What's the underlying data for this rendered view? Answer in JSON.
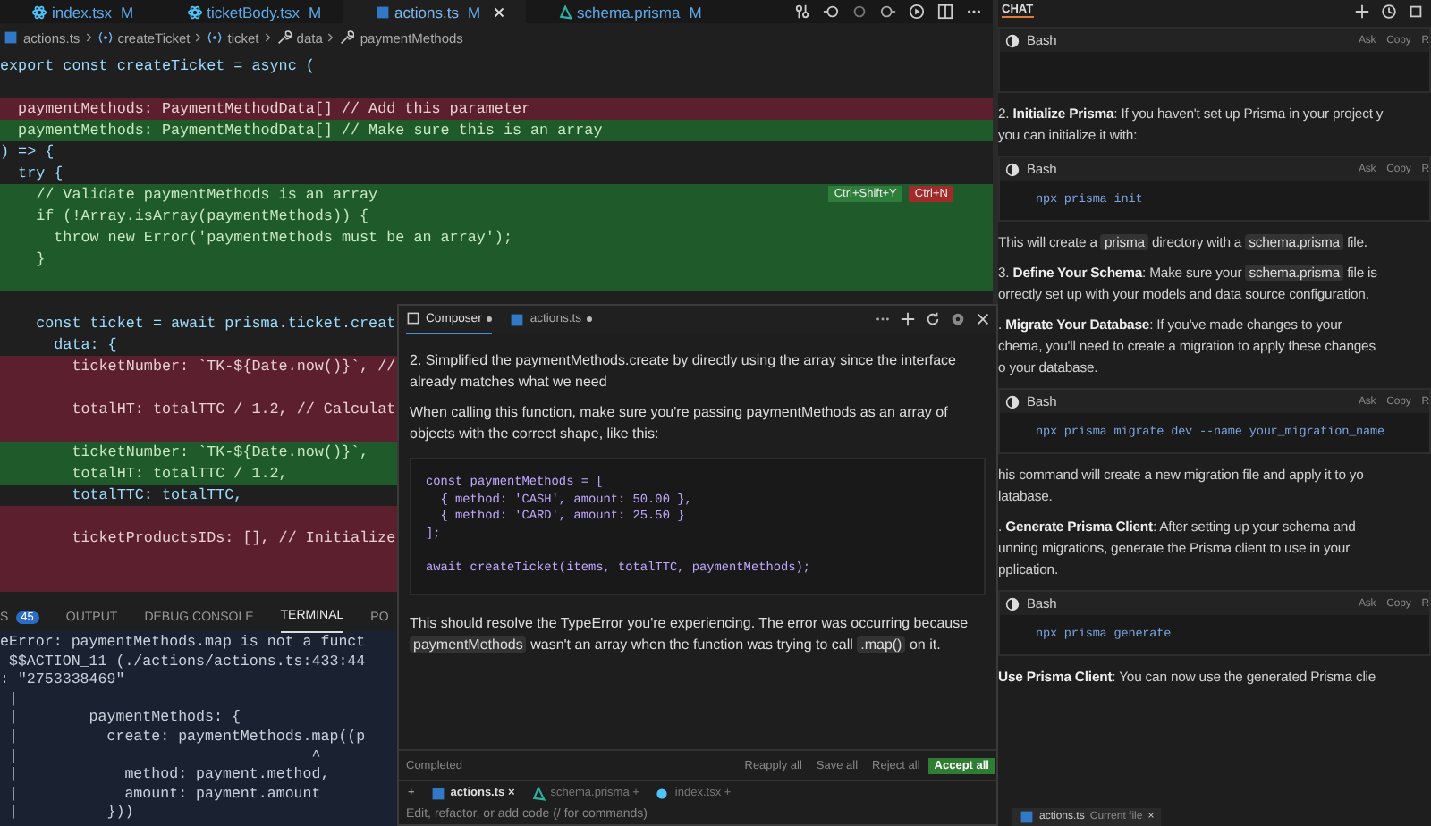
{
  "editor_tabs": [
    {
      "label": "index.tsx",
      "badge": "M",
      "kind": "react",
      "selected": false
    },
    {
      "label": "ticketBody.tsx",
      "badge": "M",
      "kind": "react",
      "selected": false
    },
    {
      "label": "actions.ts",
      "badge": "M",
      "kind": "ts",
      "selected": true
    },
    {
      "label": "schema.prisma",
      "badge": "M",
      "kind": "prisma",
      "selected": false
    }
  ],
  "breadcrumbs": [
    {
      "label": "actions.ts",
      "kind": "file"
    },
    {
      "label": "createTicket",
      "kind": "symbol"
    },
    {
      "label": "ticket",
      "kind": "symbol"
    },
    {
      "label": "data",
      "kind": "property"
    },
    {
      "label": "paymentMethods",
      "kind": "property"
    }
  ],
  "code_lines": [
    {
      "kind": "normal",
      "text": "export const createTicket = async ("
    },
    {
      "kind": "normal"
    },
    {
      "kind": "removed",
      "text": "  paymentMethods: PaymentMethodData[] // Add this parameter"
    },
    {
      "kind": "added",
      "text": "  paymentMethods: PaymentMethodData[] // Make sure this is an array"
    },
    {
      "kind": "normal",
      "text": ") => {"
    },
    {
      "kind": "normal",
      "text": "  try {"
    },
    {
      "kind": "added",
      "text": "    // Validate paymentMethods is an array",
      "keybindings": [
        {
          "label": "Ctrl+Shift+Y",
          "kind": "accept"
        },
        {
          "label": "Ctrl+N",
          "kind": "reject"
        }
      ]
    },
    {
      "kind": "added",
      "text": "    if (!Array.isArray(paymentMethods)) {"
    },
    {
      "kind": "added",
      "text": "      throw new Error('paymentMethods must be an array');"
    },
    {
      "kind": "added",
      "text": "    }"
    },
    {
      "kind": "added"
    },
    {
      "kind": "normal"
    },
    {
      "kind": "normal",
      "text": "    const ticket = await prisma.ticket.creat"
    },
    {
      "kind": "normal",
      "text": "      data: {"
    },
    {
      "kind": "removed",
      "text": "        ticketNumber: `TK-${Date.now()}`, //"
    },
    {
      "kind": "removed"
    },
    {
      "kind": "removed",
      "text": "        totalHT: totalTTC / 1.2, // Calculat"
    },
    {
      "kind": "removed"
    },
    {
      "kind": "added",
      "text": "        ticketNumber: `TK-${Date.now()}`,"
    },
    {
      "kind": "added",
      "text": "        totalHT: totalTTC / 1.2,"
    },
    {
      "kind": "normal",
      "text": "        totalTTC: totalTTC,"
    },
    {
      "kind": "removed"
    },
    {
      "kind": "removed",
      "text": "        ticketProductsIDs: [], // Initialize"
    },
    {
      "kind": "removed"
    },
    {
      "kind": "removed"
    }
  ],
  "panel": {
    "tabs": [
      {
        "label": "S",
        "count": "45",
        "selected": false
      },
      {
        "label": "OUTPUT",
        "selected": false
      },
      {
        "label": "DEBUG CONSOLE",
        "selected": false
      },
      {
        "label": "TERMINAL",
        "selected": true
      },
      {
        "label": "PO",
        "selected": false
      }
    ],
    "terminal_lines": [
      "eError: paymentMethods.map is not a funct",
      " $$ACTION_11 (./actions/actions.ts:433:44",
      ": \"2753338469\"",
      " |",
      " |        paymentMethods: {",
      " |          create: paymentMethods.map((p",
      " |                                 ^",
      " |            method: payment.method,",
      " |            amount: payment.amount",
      " |          }))"
    ]
  },
  "composer": {
    "tabs": [
      {
        "label": "Composer",
        "kind": "composer",
        "modified": true,
        "selected": true
      },
      {
        "label": "actions.ts",
        "kind": "ts",
        "modified": true,
        "selected": false
      }
    ],
    "messages": [
      {
        "kind": "paragraph",
        "segments": [
          {
            "kind": "text",
            "text": "2. Simplified the paymentMethods.create by directly using the array since the interface already matches what we need"
          }
        ]
      },
      {
        "kind": "paragraph",
        "segments": [
          {
            "kind": "text",
            "text": "When calling this function, make sure you're passing paymentMethods as an array of objects with the correct shape, like this:"
          }
        ]
      },
      {
        "kind": "code",
        "groups": [
          [
            "const paymentMethods = [",
            "  { method: 'CASH', amount: 50.00 },",
            "  { method: 'CARD', amount: 25.50 }",
            "];"
          ],
          [
            "await createTicket(items, totalTTC, paymentMethods);"
          ]
        ]
      },
      {
        "kind": "paragraph",
        "segments": [
          {
            "kind": "text",
            "text": "This should resolve the TypeError you're experiencing. The error was occurring because "
          },
          {
            "kind": "code",
            "text": "paymentMethods"
          },
          {
            "kind": "text",
            "text": " wasn't an array when the function was trying to call "
          },
          {
            "kind": "code",
            "text": ".map()"
          },
          {
            "kind": "text",
            "text": " on it."
          }
        ]
      }
    ],
    "status": "Completed",
    "actions": [
      {
        "label": "Reapply all",
        "kind": "plain"
      },
      {
        "label": "Save all",
        "kind": "plain"
      },
      {
        "label": "Reject all",
        "kind": "plain"
      },
      {
        "label": "Accept all",
        "kind": "primary"
      }
    ],
    "add_context": "+",
    "context_files": [
      {
        "label": "actions.ts",
        "kind": "ts",
        "action": "×",
        "selected": true
      },
      {
        "label": "schema.prisma",
        "kind": "prisma",
        "action": "+",
        "selected": false
      },
      {
        "label": "index.tsx",
        "kind": "react",
        "action": "+",
        "selected": false
      }
    ],
    "input": {
      "placeholder": "Edit, refactor, or add code (/ for commands)"
    }
  },
  "chat": {
    "title": "CHAT",
    "blocks": [
      {
        "kind": "bash",
        "label": "Bash",
        "actions": [
          "Ask",
          "Copy",
          "R"
        ]
      },
      {
        "kind": "paragraph",
        "lines": [
          [
            {
              "kind": "text",
              "text": "2. "
            },
            {
              "kind": "bold",
              "text": "Initialize Prisma"
            },
            {
              "kind": "text",
              "text": ": If you haven't set up Prisma in your project y"
            }
          ],
          [
            {
              "kind": "text",
              "text": "you can initialize it with:"
            }
          ]
        ]
      },
      {
        "kind": "bash",
        "label": "Bash",
        "actions": [
          "Ask",
          "Copy",
          "R"
        ],
        "code": "npx prisma init"
      },
      {
        "kind": "paragraph",
        "lines": [
          [
            {
              "kind": "text",
              "text": "This will create a "
            },
            {
              "kind": "code",
              "text": "prisma"
            },
            {
              "kind": "text",
              "text": " directory with a "
            },
            {
              "kind": "code",
              "text": "schema.prisma"
            },
            {
              "kind": "text",
              "text": " file."
            }
          ]
        ]
      },
      {
        "kind": "paragraph",
        "lines": [
          [
            {
              "kind": "text",
              "text": "3. "
            },
            {
              "kind": "bold",
              "text": "Define Your Schema"
            },
            {
              "kind": "text",
              "text": ": Make sure your "
            },
            {
              "kind": "code",
              "text": "schema.prisma"
            },
            {
              "kind": "text",
              "text": " file is"
            }
          ],
          [
            {
              "kind": "text",
              "text": "orrectly set up with your models and data source configuration."
            }
          ]
        ]
      },
      {
        "kind": "paragraph",
        "lines": [
          [
            {
              "kind": "text",
              "text": ". "
            },
            {
              "kind": "bold",
              "text": "Migrate Your Database"
            },
            {
              "kind": "text",
              "text": ": If you've made changes to your"
            }
          ],
          [
            {
              "kind": "text",
              "text": "chema, you'll need to create a migration to apply these changes"
            }
          ],
          [
            {
              "kind": "text",
              "text": "o your database."
            }
          ]
        ]
      },
      {
        "kind": "bash",
        "label": "Bash",
        "actions": [
          "Ask",
          "Copy",
          "R"
        ],
        "code": "npx prisma migrate dev --name your_migration_name"
      },
      {
        "kind": "paragraph",
        "lines": [
          [
            {
              "kind": "text",
              "text": "his command will create a new migration file and apply it to yo"
            }
          ],
          [
            {
              "kind": "text",
              "text": "latabase."
            }
          ]
        ]
      },
      {
        "kind": "paragraph",
        "lines": [
          [
            {
              "kind": "text",
              "text": ". "
            },
            {
              "kind": "bold",
              "text": "Generate Prisma Client"
            },
            {
              "kind": "text",
              "text": ": After setting up your schema and"
            }
          ],
          [
            {
              "kind": "text",
              "text": "unning migrations, generate the Prisma client to use in your"
            }
          ],
          [
            {
              "kind": "text",
              "text": "pplication."
            }
          ]
        ]
      },
      {
        "kind": "bash",
        "label": "Bash",
        "actions": [
          "Ask",
          "Copy",
          "R"
        ],
        "code": "npx prisma generate"
      },
      {
        "kind": "paragraph",
        "lines": [
          [
            {
              "kind": "bold",
              "text": "Use Prisma Client"
            },
            {
              "kind": "text",
              "text": ": You can now use the generated Prisma clie"
            }
          ]
        ]
      }
    ],
    "context_chip": {
      "file": "actions.ts",
      "note": "Current file",
      "action": "×"
    }
  }
}
